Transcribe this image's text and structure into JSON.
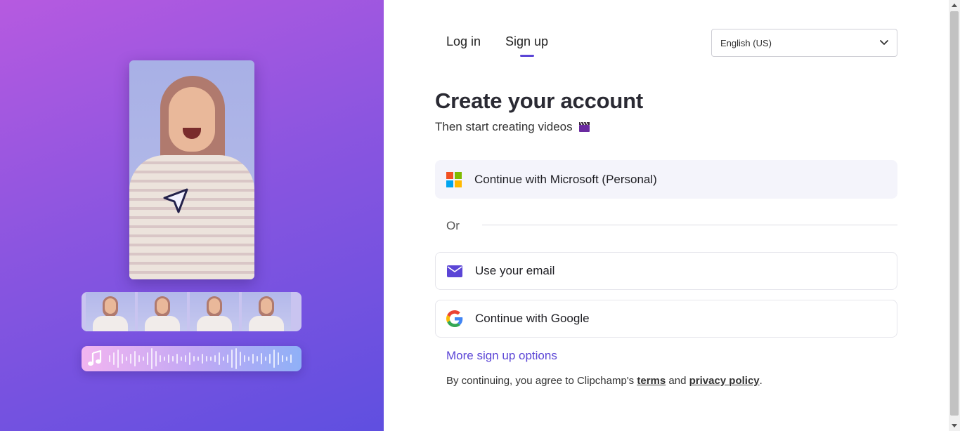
{
  "tabs": {
    "login": "Log in",
    "signup": "Sign up",
    "active": "signup"
  },
  "language": {
    "selected": "English (US)"
  },
  "heading": {
    "title": "Create your account",
    "subtitle": "Then start creating videos"
  },
  "options": {
    "microsoft": "Continue with Microsoft (Personal)",
    "or_text": "Or",
    "email": "Use your email",
    "google": "Continue with Google"
  },
  "more_options": "More sign up options",
  "legal": {
    "prefix": "By continuing, you agree to Clipchamp's",
    "terms": "terms",
    "and": "and",
    "privacy": "privacy policy",
    "suffix": "."
  },
  "icons": {
    "microsoft": "microsoft-logo-icon",
    "email": "envelope-icon",
    "google": "google-logo-icon",
    "chevron": "chevron-down-icon",
    "clapper": "clapper-board-icon",
    "cursor": "navigation-arrow-icon",
    "music": "music-note-icon"
  },
  "colors": {
    "accent": "#5b45d6",
    "panel_gradient_start": "#b65ae0",
    "panel_gradient_end": "#5f4fe0",
    "ms_button_bg": "#f4f4fb"
  }
}
